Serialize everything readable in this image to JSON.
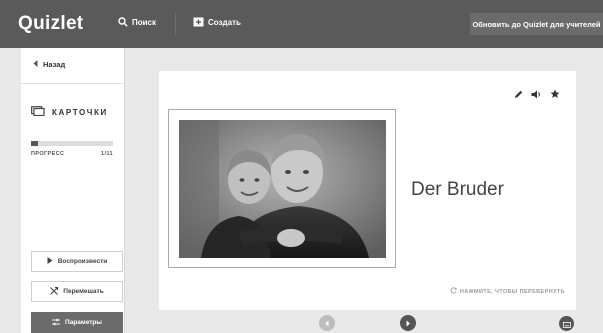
{
  "header": {
    "logo": "Quizlet",
    "search_label": "Поиск",
    "create_label": "Создать",
    "upgrade_label": "Обновить до Quizlet для учителей"
  },
  "sidebar": {
    "back_label": "Назад",
    "mode_title": "КАРТОЧКИ",
    "progress_label": "ПРОГРЕСС",
    "progress_count": "1/11",
    "progress_fraction": 0.09,
    "play_label": "Воспроизвести",
    "shuffle_label": "Перемешать",
    "options_label": "Параметры"
  },
  "card": {
    "term": "Der Bruder",
    "flip_hint": "НАЖМИТЕ, ЧТОБЫ ПЕРЕВЕРНУТЬ",
    "icons": [
      "pencil-icon",
      "speaker-icon",
      "star-icon"
    ]
  },
  "colors": {
    "topbar": "#5a5a5a",
    "page_bg": "#e9e9e9",
    "card_bg": "#ffffff",
    "accent_dark": "#555555"
  }
}
